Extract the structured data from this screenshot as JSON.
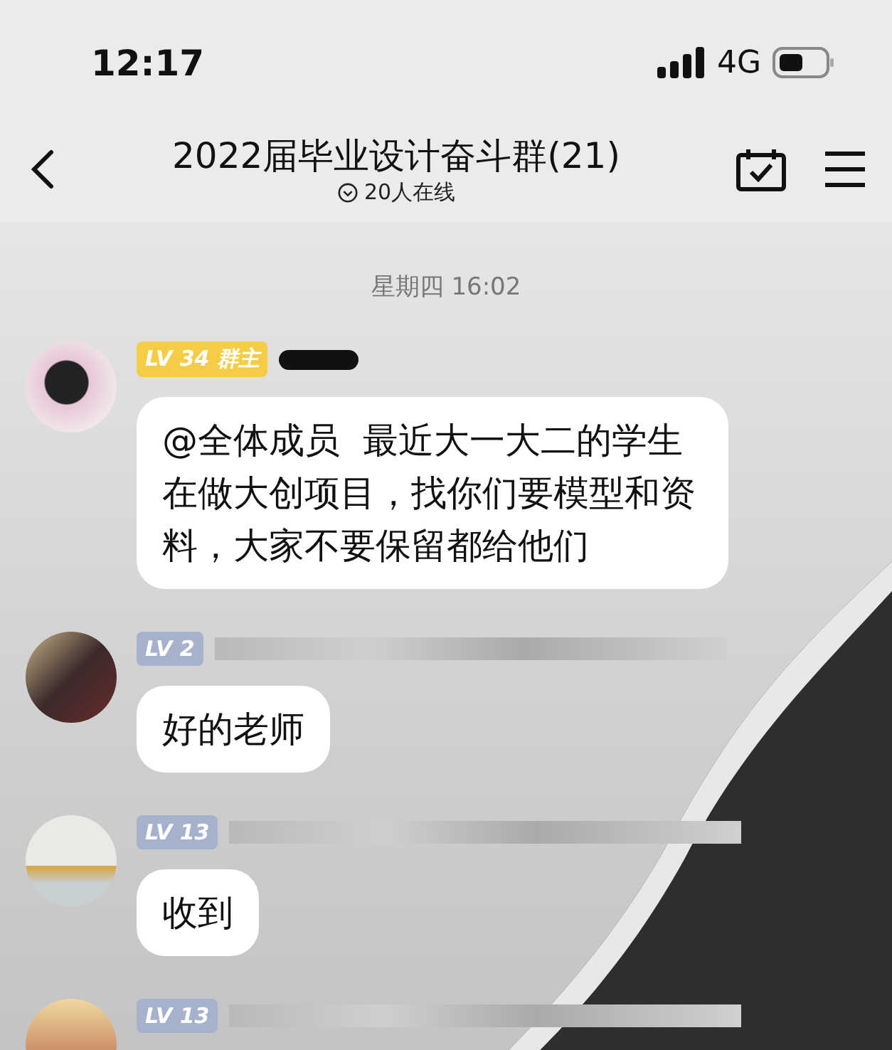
{
  "status_bar": {
    "time": "12:17",
    "network": "4G"
  },
  "header": {
    "title": "2022届毕业设计奋斗群(21)",
    "subtitle": "20人在线"
  },
  "date_divider": "星期四 16:02",
  "messages": [
    {
      "badge": "LV 34 群主",
      "kind": "owner",
      "text": "@全体成员  最近大一大二的学生在做大创项目，找你们要模型和资料，大家不要保留都给他们"
    },
    {
      "badge": "LV 2",
      "kind": "member",
      "text": "好的老师"
    },
    {
      "badge": "LV 13",
      "kind": "member",
      "text": "收到"
    },
    {
      "badge": "LV 13",
      "kind": "member"
    }
  ]
}
